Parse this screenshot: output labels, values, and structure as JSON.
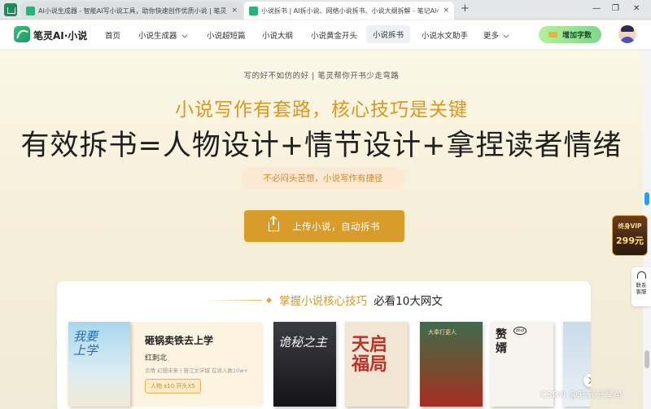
{
  "browser": {
    "tabs": [
      {
        "title": "AI小说生成器 - 智能AI写小说工具，助你快速创作优质小说 | 笔灵ai写作",
        "close": "×"
      },
      {
        "title": "小说拆书 | AI拆小说、网络小说拆书、小说大纲拆解 - 笔记AI小说",
        "close": "×"
      }
    ],
    "new_tab": "+",
    "window_controls": {
      "minimize": "—",
      "restore": "❐",
      "close": "✕"
    }
  },
  "header": {
    "logo_text": "笔灵AI·小说",
    "nav": [
      {
        "label": "首页"
      },
      {
        "label": "小说生成器",
        "dropdown": true
      },
      {
        "label": "小说超短篇"
      },
      {
        "label": "小说大纲"
      },
      {
        "label": "小说黄金开头"
      },
      {
        "label": "小说拆书",
        "active": true
      },
      {
        "label": "小说水文助手"
      },
      {
        "label": "更多",
        "dropdown": true
      }
    ],
    "words_button": "增加字数"
  },
  "hero": {
    "tagline": "写的好不如仿的好 | 笔灵帮你开书少走弯路",
    "slogan": "小说写作有套路，核心技巧是关键",
    "headline": "有效拆书=人物设计+情节设计+拿捏读者情绪",
    "pill": "不必闷头苦想，小说写作有捷径",
    "upload_button": "上传小说，自动拆书"
  },
  "section": {
    "title_highlight": "掌握小说核心技巧",
    "title_rest": "必看10大网文",
    "featured": {
      "cover_text": "我要上学",
      "title": "砸锅卖铁去上学",
      "author": "红刺北",
      "tags": "言情  幻想未来  |  晋江文学城  在读人数10w+",
      "badge": "人物 x10  开头X5"
    },
    "books": [
      {
        "cover_text": "诡秘之主"
      },
      {
        "cover_text": "天启福局"
      },
      {
        "cover_text": "大奉打更人"
      },
      {
        "cover_text": "赘婿",
        "seal": "zhui"
      },
      {
        "cover_text": ""
      }
    ]
  },
  "sidebar": {
    "vip_line1": "终身VIP",
    "vip_line2": "299元",
    "contact": "联系\n客服"
  },
  "watermark": "CSDN @轩轩分享AI",
  "colors": {
    "accent": "#d89c2b",
    "brand_green": "#1d9a62",
    "hero_bg": "#f6efd9"
  }
}
